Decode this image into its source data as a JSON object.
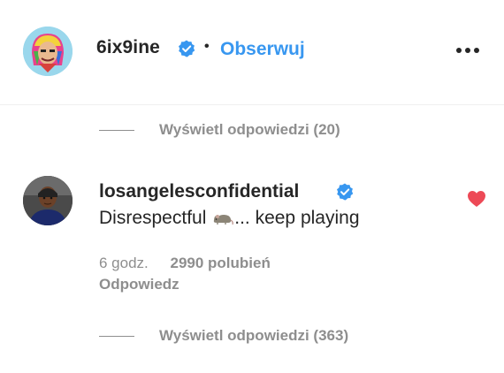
{
  "header": {
    "username": "6ix9ine",
    "verified": true,
    "separator": "•",
    "follow_label": "Obserwuj",
    "more_icon": "more-horizontal-icon"
  },
  "replies_top": {
    "label": "Wyświetl odpowiedzi (20)"
  },
  "comment": {
    "username": "losangelesconfidential",
    "verified": true,
    "text_before": "Disrespectful",
    "emoji": "rat-emoji",
    "text_after": "... keep playing",
    "time": "6 godz.",
    "likes": "2990 polubień",
    "reply_label": "Odpowiedz",
    "liked": true
  },
  "replies_bottom": {
    "label": "Wyświetl odpowiedzi (363)"
  },
  "colors": {
    "accent": "#3897f0",
    "verified": "#3897f0",
    "heart": "#ed4956",
    "muted": "#8e8e8e",
    "text": "#262626"
  }
}
